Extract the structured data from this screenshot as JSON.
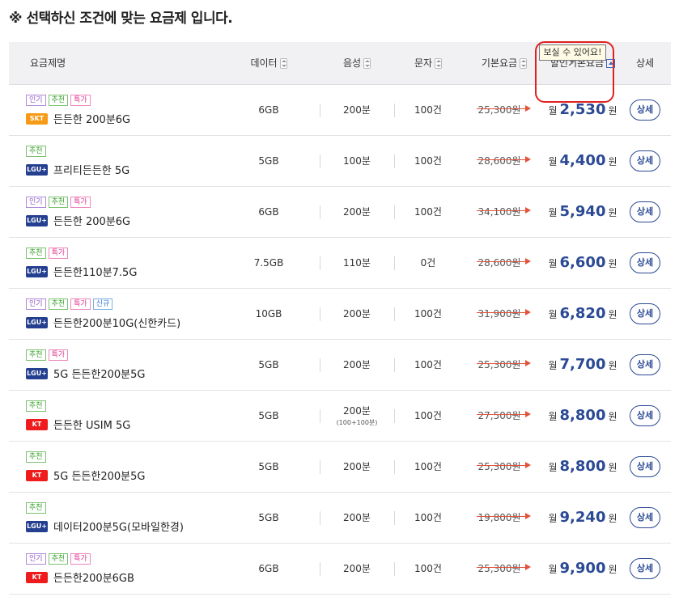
{
  "page": {
    "title": "※ 선택하신 조건에 맞는 요금제 입니다."
  },
  "table": {
    "headers": {
      "plan": "요금제명",
      "data": "데이터",
      "voice": "음성",
      "sms": "문자",
      "base": "기본요금",
      "discount": "할인기본요금",
      "detail": "상세"
    },
    "tooltip": "보실 수 있어요!",
    "month_label": "월",
    "won_label": "원",
    "detail_label": "상세",
    "badge_labels": {
      "pop": "인기",
      "rec": "추천",
      "sale": "특가",
      "new": "신규"
    },
    "carrier_colors": {
      "SKT": "#f79a16",
      "LGU+": "#243f8f",
      "KT": "#ee1c1c"
    },
    "rows": [
      {
        "badges": [
          "pop",
          "rec",
          "sale"
        ],
        "carrier": "SKT",
        "name": "든든한 200분6G",
        "data": "6GB",
        "voice": "200분",
        "voice_sub": "",
        "sms": "100건",
        "base": "25,300원",
        "price": "2,530"
      },
      {
        "badges": [
          "rec"
        ],
        "carrier": "LGU+",
        "name": "프리티든든한 5G",
        "data": "5GB",
        "voice": "100분",
        "voice_sub": "",
        "sms": "100건",
        "base": "28,600원",
        "price": "4,400"
      },
      {
        "badges": [
          "pop",
          "rec",
          "sale"
        ],
        "carrier": "LGU+",
        "name": "든든한 200분6G",
        "data": "6GB",
        "voice": "200분",
        "voice_sub": "",
        "sms": "100건",
        "base": "34,100원",
        "price": "5,940"
      },
      {
        "badges": [
          "rec",
          "sale"
        ],
        "carrier": "LGU+",
        "name": "든든한110분7.5G",
        "data": "7.5GB",
        "voice": "110분",
        "voice_sub": "",
        "sms": "0건",
        "base": "28,600원",
        "price": "6,600"
      },
      {
        "badges": [
          "pop",
          "rec",
          "sale",
          "new"
        ],
        "carrier": "LGU+",
        "name": "든든한200분10G(신한카드)",
        "data": "10GB",
        "voice": "200분",
        "voice_sub": "",
        "sms": "100건",
        "base": "31,900원",
        "price": "6,820"
      },
      {
        "badges": [
          "rec",
          "sale"
        ],
        "carrier": "LGU+",
        "name": "5G 든든한200분5G",
        "data": "5GB",
        "voice": "200분",
        "voice_sub": "",
        "sms": "100건",
        "base": "25,300원",
        "price": "7,700"
      },
      {
        "badges": [
          "rec"
        ],
        "carrier": "KT",
        "name": "든든한 USIM 5G",
        "data": "5GB",
        "voice": "200분",
        "voice_sub": "(100+100분)",
        "sms": "100건",
        "base": "27,500원",
        "price": "8,800"
      },
      {
        "badges": [
          "rec"
        ],
        "carrier": "KT",
        "name": "5G 든든한200분5G",
        "data": "5GB",
        "voice": "200분",
        "voice_sub": "",
        "sms": "100건",
        "base": "25,300원",
        "price": "8,800"
      },
      {
        "badges": [
          "rec"
        ],
        "carrier": "LGU+",
        "name": "데이터200분5G(모바일한경)",
        "data": "5GB",
        "voice": "200분",
        "voice_sub": "",
        "sms": "100건",
        "base": "19,800원",
        "price": "9,240"
      },
      {
        "badges": [
          "pop",
          "rec",
          "sale"
        ],
        "carrier": "KT",
        "name": "든든한200분6GB",
        "data": "6GB",
        "voice": "200분",
        "voice_sub": "",
        "sms": "100건",
        "base": "25,300원",
        "price": "9,900"
      }
    ]
  }
}
